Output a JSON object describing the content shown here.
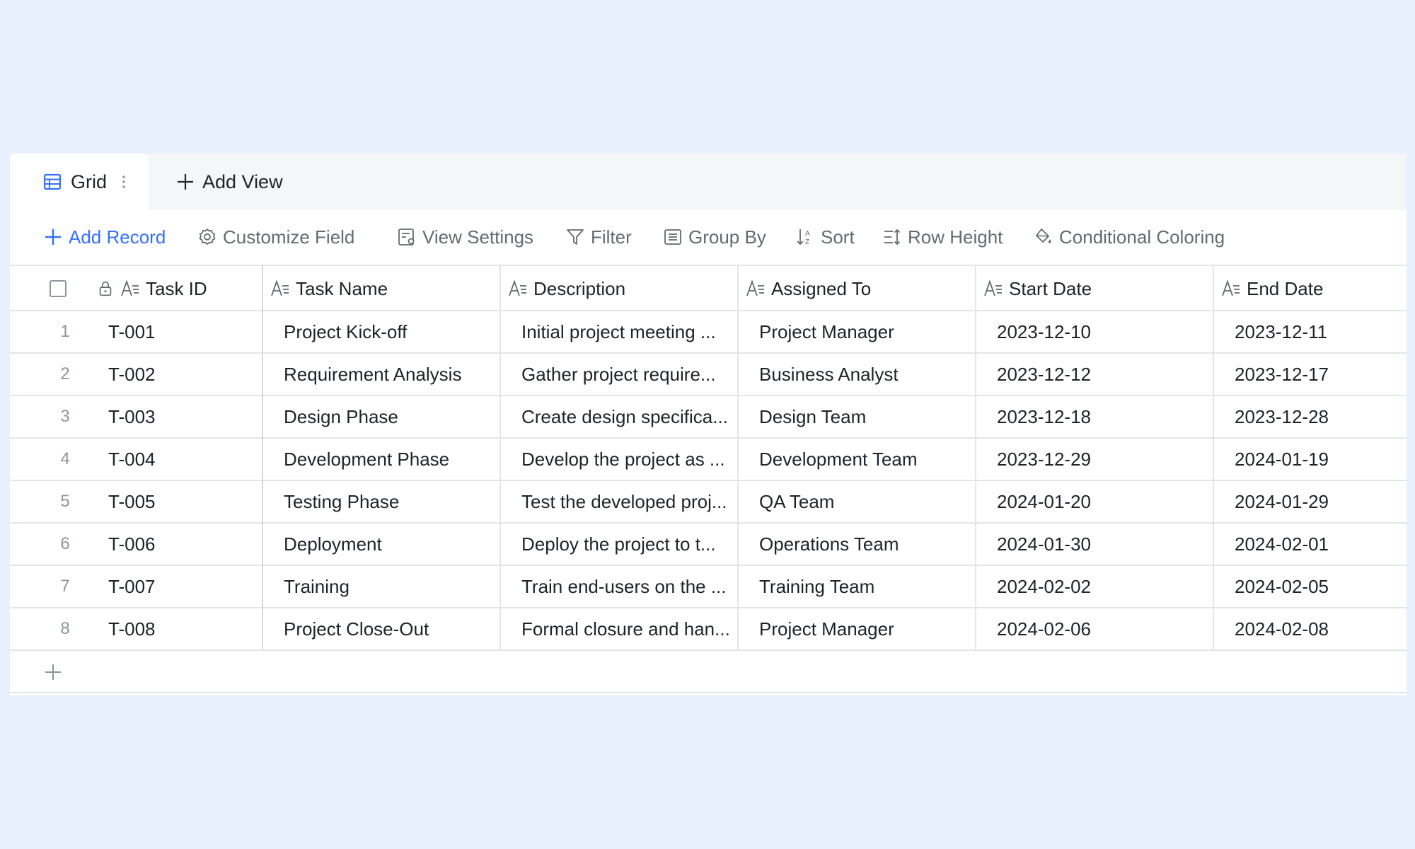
{
  "tabs": {
    "active": {
      "label": "Grid",
      "icon": "grid-table-icon"
    },
    "add_view_label": "Add View"
  },
  "toolbar": {
    "add_record": "Add Record",
    "customize_field": "Customize Field",
    "view_settings": "View Settings",
    "filter": "Filter",
    "group_by": "Group By",
    "sort": "Sort",
    "row_height": "Row Height",
    "conditional_coloring": "Conditional Coloring"
  },
  "columns": [
    {
      "label": "Task ID",
      "icon": "text-field-icon",
      "locked": true
    },
    {
      "label": "Task Name",
      "icon": "text-field-icon"
    },
    {
      "label": "Description",
      "icon": "text-field-icon"
    },
    {
      "label": "Assigned To",
      "icon": "text-field-icon"
    },
    {
      "label": "Start Date",
      "icon": "text-field-icon"
    },
    {
      "label": "End Date",
      "icon": "text-field-icon"
    }
  ],
  "rows": [
    {
      "num": "1",
      "task_id": "T-001",
      "task_name": "Project Kick-off",
      "description": "Initial project meeting ...",
      "assigned_to": "Project Manager",
      "start_date": "2023-12-10",
      "end_date": "2023-12-11"
    },
    {
      "num": "2",
      "task_id": "T-002",
      "task_name": "Requirement Analysis",
      "description": "Gather project require...",
      "assigned_to": "Business Analyst",
      "start_date": "2023-12-12",
      "end_date": "2023-12-17"
    },
    {
      "num": "3",
      "task_id": "T-003",
      "task_name": "Design Phase",
      "description": "Create design specifica...",
      "assigned_to": "Design Team",
      "start_date": "2023-12-18",
      "end_date": "2023-12-28"
    },
    {
      "num": "4",
      "task_id": "T-004",
      "task_name": "Development Phase",
      "description": "Develop the project as ...",
      "assigned_to": "Development Team",
      "start_date": "2023-12-29",
      "end_date": "2024-01-19"
    },
    {
      "num": "5",
      "task_id": "T-005",
      "task_name": "Testing Phase",
      "description": "Test the developed proj...",
      "assigned_to": "QA Team",
      "start_date": "2024-01-20",
      "end_date": "2024-01-29"
    },
    {
      "num": "6",
      "task_id": "T-006",
      "task_name": "Deployment",
      "description": "Deploy the project to t...",
      "assigned_to": "Operations Team",
      "start_date": "2024-01-30",
      "end_date": "2024-02-01"
    },
    {
      "num": "7",
      "task_id": "T-007",
      "task_name": "Training",
      "description": "Train end-users on the ...",
      "assigned_to": "Training Team",
      "start_date": "2024-02-02",
      "end_date": "2024-02-05"
    },
    {
      "num": "8",
      "task_id": "T-008",
      "task_name": "Project Close-Out",
      "description": "Formal closure and han...",
      "assigned_to": "Project Manager",
      "start_date": "2024-02-06",
      "end_date": "2024-02-08"
    }
  ],
  "colors": {
    "accent": "#3370ff",
    "background": "#e8effd",
    "text": "#1f2329",
    "muted": "#646a73"
  }
}
